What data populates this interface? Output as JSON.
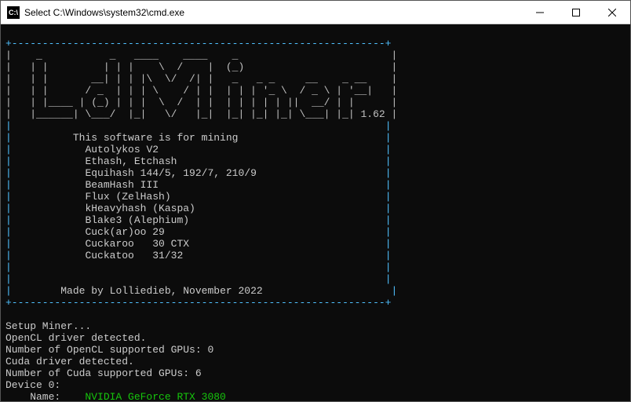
{
  "window": {
    "title": "Select C:\\Windows\\system32\\cmd.exe",
    "icon_label": "C:\\"
  },
  "banner": {
    "border_top": "+-------------------------------------------------------------+",
    "border_bot": "+-------------------------------------------------------------+",
    "side": "|",
    "ascii": [
      "|    _           _   ____    ____    _                         |",
      "|   | |         | | |    \\  /    |  (_)                        |",
      "|   | |       __| | | |\\  \\/  /| |   _   _ _     __    _ __    |",
      "|   | |      / _  | | | \\    / | |  | | | '_ \\  / _ \\ | '__|   |",
      "|   | |____ | (_) | | |  \\  /  | |  | | | | | ||  __/ | |      |",
      "|   |______| \\___/  |_|   \\/   |_|  |_| |_| |_| \\___| |_| 1.62 |"
    ],
    "intro_header": "This software is for mining",
    "algorithms": [
      "Autolykos V2",
      "Ethash, Etchash",
      "Equihash 144/5, 192/7, 210/9",
      "BeamHash III",
      "Flux (ZelHash)",
      "kHeavyhash (Kaspa)",
      "Blake3 (Alephium)",
      "Cuck(ar)oo 29",
      "Cuckaroo   30 CTX",
      "Cuckatoo   31/32"
    ],
    "credit": "Made by Lolliedieb, November 2022"
  },
  "log": {
    "lines": [
      "Setup Miner...",
      "OpenCL driver detected.",
      "Number of OpenCL supported GPUs: 0",
      "Cuda driver detected.",
      "Number of Cuda supported GPUs: 6",
      "Device 0:"
    ],
    "gpu_label": "    Name:    ",
    "gpu_name": "NVIDIA GeForce RTX 3080"
  }
}
